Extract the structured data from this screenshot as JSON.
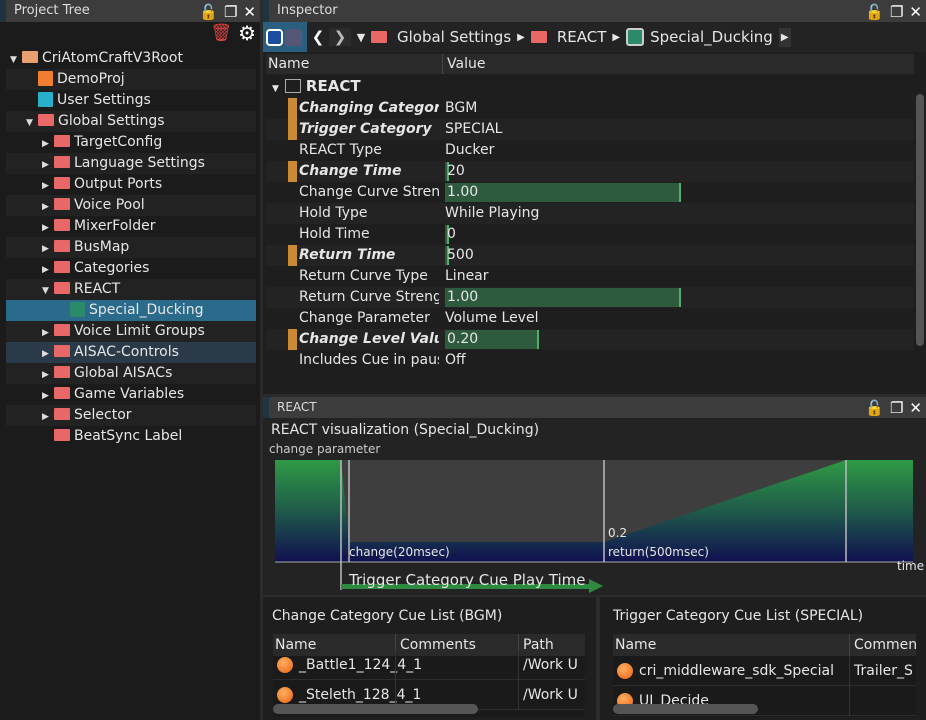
{
  "project_tree": {
    "title": "Project Tree",
    "items": [
      {
        "label": "CriAtomCraftV3Root",
        "indent": 0,
        "arrow": "down",
        "icon": "folder-orange-icon"
      },
      {
        "label": "DemoProj",
        "indent": 1,
        "arrow": "",
        "icon": "project-icon"
      },
      {
        "label": "User Settings",
        "indent": 1,
        "arrow": "",
        "icon": "user-icon"
      },
      {
        "label": "Global Settings",
        "indent": 1,
        "arrow": "down",
        "icon": "folder-icon"
      },
      {
        "label": "TargetConfig",
        "indent": 2,
        "arrow": "right",
        "icon": "folder-icon"
      },
      {
        "label": "Language Settings",
        "indent": 2,
        "arrow": "right",
        "icon": "folder-icon"
      },
      {
        "label": "Output Ports",
        "indent": 2,
        "arrow": "right",
        "icon": "folder-icon"
      },
      {
        "label": "Voice Pool",
        "indent": 2,
        "arrow": "right",
        "icon": "folder-icon"
      },
      {
        "label": "MixerFolder",
        "indent": 2,
        "arrow": "right",
        "icon": "folder-icon"
      },
      {
        "label": "BusMap",
        "indent": 2,
        "arrow": "right",
        "icon": "folder-icon"
      },
      {
        "label": "Categories",
        "indent": 2,
        "arrow": "right",
        "icon": "folder-icon"
      },
      {
        "label": "REACT",
        "indent": 2,
        "arrow": "down",
        "icon": "folder-icon"
      },
      {
        "label": "Special_Ducking",
        "indent": 3,
        "arrow": "",
        "icon": "react-icon",
        "selected": true
      },
      {
        "label": "Voice Limit Groups",
        "indent": 2,
        "arrow": "right",
        "icon": "folder-icon"
      },
      {
        "label": "AISAC-Controls",
        "indent": 2,
        "arrow": "right",
        "icon": "folder-icon",
        "hover": true
      },
      {
        "label": "Global AISACs",
        "indent": 2,
        "arrow": "right",
        "icon": "folder-icon"
      },
      {
        "label": "Game Variables",
        "indent": 2,
        "arrow": "right",
        "icon": "folder-icon"
      },
      {
        "label": "Selector",
        "indent": 2,
        "arrow": "right",
        "icon": "folder-icon"
      },
      {
        "label": "BeatSync Label",
        "indent": 2,
        "arrow": "",
        "icon": "folder-icon"
      }
    ]
  },
  "inspector": {
    "title": "Inspector",
    "breadcrumb": [
      "Global Settings",
      "REACT",
      "Special_Ducking"
    ],
    "col_name": "Name",
    "col_value": "Value",
    "group": "REACT",
    "properties": [
      {
        "name": "Changing Category",
        "value": "BGM",
        "modified": true
      },
      {
        "name": "Trigger Category",
        "value": "SPECIAL",
        "modified": true
      },
      {
        "name": "REACT Type",
        "value": "Ducker"
      },
      {
        "name": "Change Time",
        "value": "20",
        "modified": true,
        "bar": 0.005
      },
      {
        "name": "Change Curve Strength",
        "value": "1.00",
        "bar": 1.0
      },
      {
        "name": "Hold Type",
        "value": "While Playing"
      },
      {
        "name": "Hold Time",
        "value": "0",
        "bar": 0.003
      },
      {
        "name": "Return Time",
        "value": "500",
        "modified": true,
        "bar": 0.01
      },
      {
        "name": "Return Curve Type",
        "value": "Linear"
      },
      {
        "name": "Return Curve Strength",
        "value": "1.00",
        "bar": 1.0
      },
      {
        "name": "Change Parameter",
        "value": "Volume Level"
      },
      {
        "name": "Change Level Value",
        "value": "0.20",
        "modified": true,
        "bar": 0.4
      },
      {
        "name": "Includes Cue in pause",
        "value": "Off"
      }
    ]
  },
  "react_panel": {
    "title": "REACT",
    "heading": "REACT visualization (Special_Ducking)",
    "y_label": "change parameter",
    "x_label": "time",
    "level_label": "0.2",
    "change_label": "change(20msec)",
    "return_label": "return(500msec)",
    "play_label": "Trigger Category Cue Play Time"
  },
  "change_list": {
    "title": "Change Category Cue List (BGM)",
    "columns": [
      "Name",
      "Comments",
      "Path"
    ],
    "rows": [
      [
        "_Battle1_124_4_1",
        "",
        "/Work U"
      ],
      [
        "_Steleth_128_4_1",
        "",
        "/Work U"
      ]
    ]
  },
  "trigger_list": {
    "title": "Trigger Category Cue List (SPECIAL)",
    "columns": [
      "Name",
      "Comments"
    ],
    "rows": [
      [
        "cri_middleware_sdk_Special",
        "Trailer_S"
      ],
      [
        "UI_Decide",
        ""
      ]
    ]
  },
  "colors": {
    "selected": "#2a6a8a",
    "modified_mark": "#c98a33",
    "value_bar": "#2e5a3e",
    "folder": "#e86868"
  }
}
